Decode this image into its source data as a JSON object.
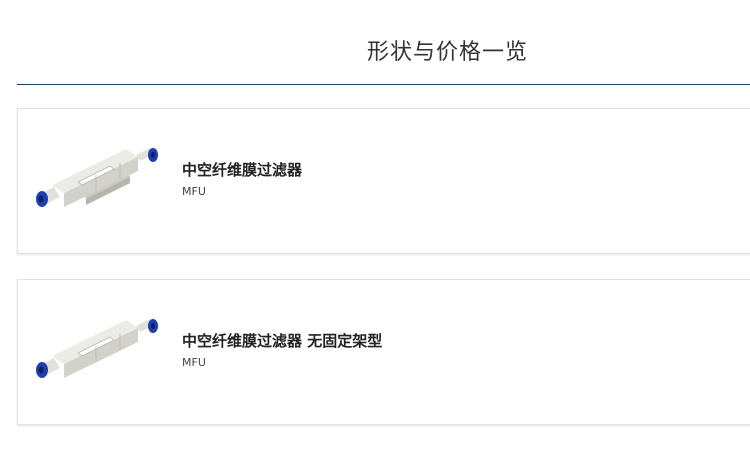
{
  "section": {
    "title": "形状与价格一览"
  },
  "products": [
    {
      "name": "中空纤维膜过滤器",
      "code": "MFU",
      "image_icon": "hollow-fiber-filter-with-bracket"
    },
    {
      "name": "中空纤维膜过滤器 无固定架型",
      "code": "MFU",
      "image_icon": "hollow-fiber-filter-no-bracket"
    }
  ],
  "colors": {
    "divider": "#1f3f5a",
    "fitting_blue": "#1e3fb0",
    "body_gray": "#dcdcd6"
  }
}
